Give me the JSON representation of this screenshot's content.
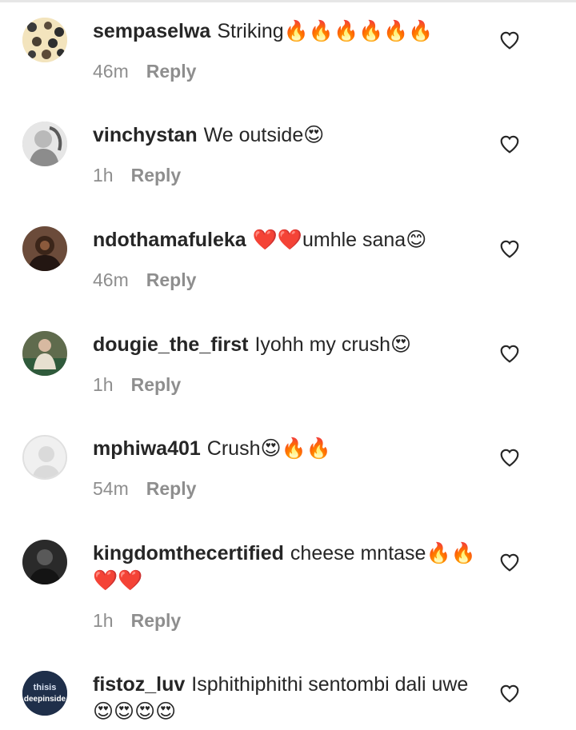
{
  "comments": [
    {
      "username": "sempaselwa",
      "text": "Striking🔥🔥🔥🔥🔥🔥",
      "time": "46m",
      "reply": "Reply",
      "avatar": "avatar-pattern-icon"
    },
    {
      "username": "vinchystan",
      "text": "We outside😍",
      "time": "1h",
      "reply": "Reply",
      "avatar": "avatar-photo-icon"
    },
    {
      "username": "ndothamafuleka",
      "text": "❤️❤️umhle sana😊",
      "time": "46m",
      "reply": "Reply",
      "avatar": "avatar-photo-icon"
    },
    {
      "username": "dougie_the_first",
      "text": "Iyohh my crush😍",
      "time": "1h",
      "reply": "Reply",
      "avatar": "avatar-photo-icon"
    },
    {
      "username": "mphiwa401",
      "text": "Crush😍🔥🔥",
      "time": "54m",
      "reply": "Reply",
      "avatar": "default-avatar-icon"
    },
    {
      "username": "kingdomthecertified",
      "text": "cheese mntase🔥🔥❤️❤️",
      "time": "1h",
      "reply": "Reply",
      "avatar": "avatar-photo-icon"
    },
    {
      "username": "fistoz_luv",
      "text": "Isphithiphithi sentombi dali uwe 😍😍😍😍",
      "time": "",
      "reply": "",
      "avatar": "avatar-logo-icon",
      "avatar_text_1": "thisis",
      "avatar_text_2": "deepinside"
    }
  ],
  "colors": {
    "username": "#262626",
    "text": "#262626",
    "meta": "#8e8e8e",
    "divider": "#e6e6e6"
  },
  "icons": {
    "like": "heart-outline-icon"
  }
}
